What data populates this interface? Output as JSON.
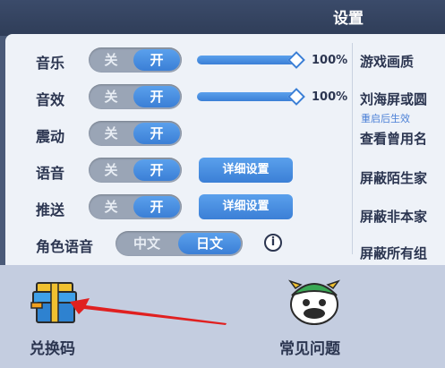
{
  "header": {
    "title": "设置"
  },
  "toggles": {
    "off_label": "关",
    "on_label": "开"
  },
  "rows": [
    {
      "label": "音乐",
      "volume_percent": 100,
      "volume_text": "100%"
    },
    {
      "label": "音效",
      "volume_percent": 100,
      "volume_text": "100%"
    },
    {
      "label": "震动"
    },
    {
      "label": "语音",
      "detail_button": "详细设置"
    },
    {
      "label": "推送",
      "detail_button": "详细设置"
    }
  ],
  "voice_lang": {
    "label": "角色语音",
    "options": [
      "中文",
      "日文"
    ],
    "selected": "日文"
  },
  "info_glyph": "i",
  "right_column": [
    {
      "label": "游戏画质"
    },
    {
      "label": "刘海屏或圆",
      "note": "重启后生效"
    },
    {
      "label": "查看曾用名"
    },
    {
      "label": "屏蔽陌生家"
    },
    {
      "label": "屏蔽非本家"
    },
    {
      "label": "屏蔽所有组"
    }
  ],
  "bottom": {
    "redeem_label": "兑换码",
    "faq_label": "常见问题"
  },
  "icons": {
    "redeem": "gift-box-icon",
    "faq": "mascot-icon",
    "info": "info-icon"
  },
  "colors": {
    "accent": "#3b7fd6",
    "toggle_off": "#9aa5b6",
    "panel": "#eef2f8",
    "bottom": "#c4cde0",
    "arrow": "#e02020"
  }
}
